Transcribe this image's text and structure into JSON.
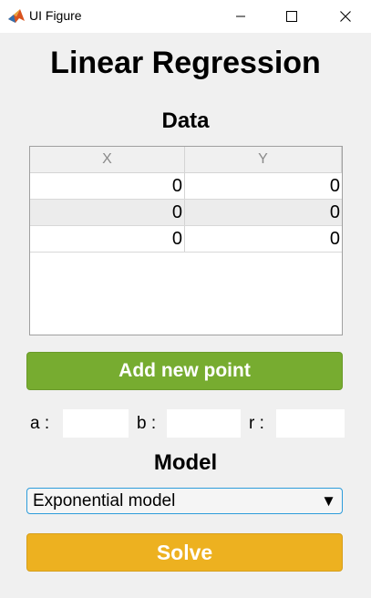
{
  "window": {
    "title": "UI Figure",
    "controls": {
      "minimize": "minimize-icon",
      "maximize": "maximize-icon",
      "close": "close-icon"
    }
  },
  "main_title": "Linear Regression",
  "data_section": {
    "title": "Data",
    "columns": [
      "X",
      "Y"
    ],
    "rows": [
      [
        "0",
        "0"
      ],
      [
        "0",
        "0"
      ],
      [
        "0",
        "0"
      ]
    ]
  },
  "add_button_label": "Add new point",
  "params": {
    "a_label": "a :",
    "b_label": "b :",
    "r_label": "r :",
    "a_value": "",
    "b_value": "",
    "r_value": ""
  },
  "model_section": {
    "title": "Model",
    "selected": "Exponential model",
    "arrow": "▼"
  },
  "solve_button_label": "Solve",
  "colors": {
    "add_button": "#77ac30",
    "solve_button": "#edb120",
    "dropdown_border": "#2d9cdb"
  }
}
